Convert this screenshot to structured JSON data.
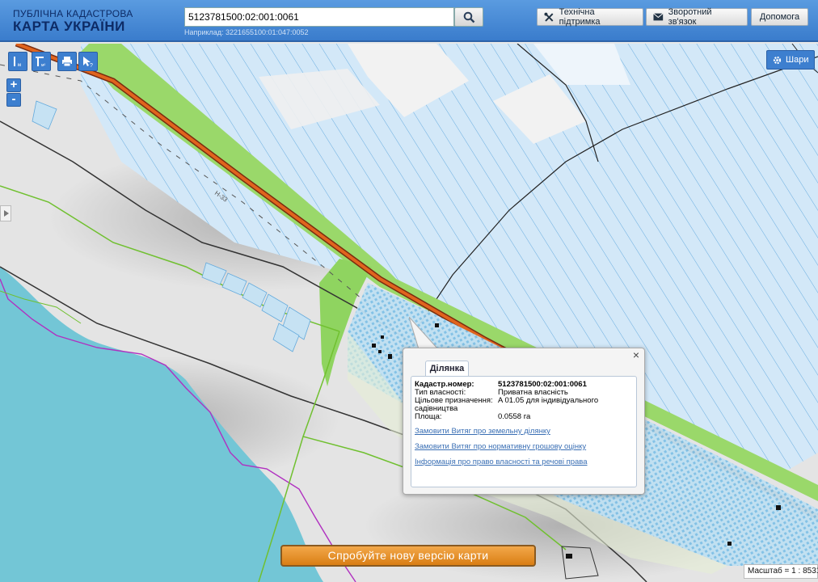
{
  "header": {
    "logo_line1": "ПУБЛІЧНА КАДАСТРОВА",
    "logo_line2": "КАРТА УКРАЇНИ",
    "search_value": "5123781500:02:001:0061",
    "example_text": "Наприклад: 3221655100:01:047:0052",
    "buttons": {
      "support": "Технічна підтримка",
      "feedback": "Зворотний зв'язок",
      "help": "Допомога"
    }
  },
  "map": {
    "layers_label": "Шари",
    "zoom_in": "+",
    "zoom_out": "-",
    "road_label": "Н-33",
    "scale_text": "Масштаб = 1 : 8531"
  },
  "popup": {
    "tab_label": "Ділянка",
    "fields": [
      {
        "key": "Кадастр.номер:",
        "value": "5123781500:02:001:0061",
        "bold": true
      },
      {
        "key": "Тип власності:",
        "value": "Приватна власність"
      },
      {
        "key": "Цільове призначення:",
        "value": "A 01.05 для індивідуального"
      },
      {
        "key": "садівництва",
        "value": ""
      },
      {
        "key": "Площа:",
        "value": "0.0558 га"
      }
    ],
    "links": [
      "Замовити Витяг про земельну ділянку",
      "Замовити Витяг про нормативну грошову оцінку",
      "Інформація про право власності та речові права"
    ]
  },
  "banner": {
    "new_version": "Спробуйте нову версію карти"
  },
  "colors": {
    "header": "#4a8bd8",
    "sea": "#73c6d6",
    "parcel_fill": "#cfe6f7",
    "parcel_line": "#5fa8de",
    "road": "#e0641e",
    "green_area": "#9ad86a",
    "boundary_purple": "#b030c0"
  }
}
